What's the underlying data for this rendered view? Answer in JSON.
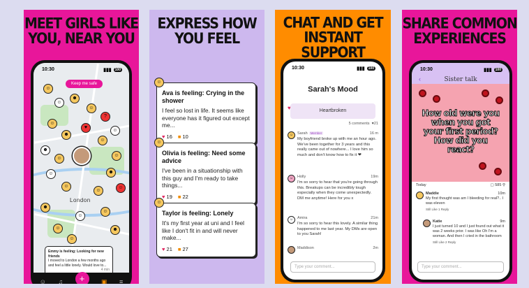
{
  "panels": [
    {
      "headline": "MEET GIRLS LIKE YOU, NEAR YOU",
      "bg": "#e8169a"
    },
    {
      "headline": "EXPRESS HOW YOU FEEL",
      "bg": "#cdb8ee"
    },
    {
      "headline": "CHAT AND GET INSTANT SUPPORT",
      "bg": "#ff8c00"
    },
    {
      "headline": "SHARE COMMON EXPERIENCES",
      "bg": "#e8169a"
    }
  ],
  "status": {
    "time": "10:30",
    "battery": "100"
  },
  "map": {
    "keep_safe": "Keep me safe",
    "city": "London",
    "card": {
      "title": "Emmy is feeling: Looking for new friends",
      "body": "I moved to London a few months ago and feel a little lonely. Would love to...",
      "time": "4 min"
    }
  },
  "feelings": [
    {
      "title": "Ava is feeling: Crying in the shower",
      "body": "I feel so lost in life. It seems like everyone has it figured out except me...",
      "hearts": "16",
      "comments": "10"
    },
    {
      "title": "Olivia is feeling: Need some advice",
      "body": "I've been in a situationship with this guy and I'm ready to take things...",
      "hearts": "19",
      "comments": "22"
    },
    {
      "title": "Taylor is feeling: Lonely",
      "body": "It's my first year at uni and I feel like I don't fit in and will never make...",
      "hearts": "21",
      "comments": "27"
    }
  ],
  "chat": {
    "title": "Sarah's Mood",
    "mood": "Heartbroken",
    "comments_count": "5 comments",
    "likes": "21",
    "messages": [
      {
        "name": "Sarah",
        "badge": "Member",
        "time": "16 m",
        "body": "My boyfriend broke up with me an hour ago. We've been together for 3 years and this really came out of nowhere... I love him so much and don't know how to fix it ❤"
      },
      {
        "name": "Holly",
        "badge": "",
        "time": "19m",
        "body": "I'm so sorry to hear that you're going through this. Breakups can be incredibly tough especially when they come unexpectedly. DM me anytime! Here for you x"
      },
      {
        "name": "Amira",
        "badge": "",
        "time": "21m",
        "body": "I'm so sorry to hear this lovely. A similar thing happened to me last year. My DMs are open to you Sarah!"
      },
      {
        "name": "Maddison",
        "badge": "",
        "time": "2m",
        "body": ""
      }
    ],
    "placeholder": "Type your comment..."
  },
  "sister": {
    "title": "Sister talk",
    "question": "How old were you when you got your first period? How did you react?",
    "day": "Today",
    "comments": "585",
    "replies": [
      {
        "name": "Maddie",
        "time": "10m",
        "body": "My first thought was am I bleeding for real?.. I was eleven",
        "acts": "Still Like   1   Reply"
      },
      {
        "name": "Katie",
        "time": "9m",
        "body": "I just turned 10 and I just found out what it was 2 weeks prior. I was like Oh I'm a woman. And then I cried in the bathroom",
        "acts": "Still Like   2   Reply"
      }
    ],
    "placeholder": "Type your comment..."
  }
}
